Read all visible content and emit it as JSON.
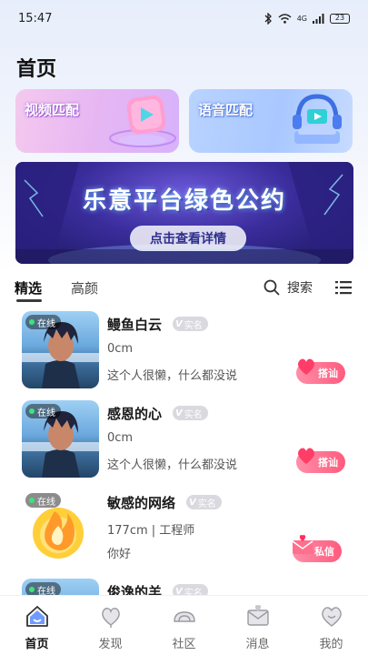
{
  "status_bar": {
    "time": "15:47",
    "network": "4G",
    "battery": "23"
  },
  "page_title": "首页",
  "match_cards": [
    {
      "label": "视频匹配"
    },
    {
      "label": "语音匹配"
    }
  ],
  "banner": {
    "title": "乐意平台绿色公约",
    "button": "点击查看详情"
  },
  "tabs": {
    "active": "精选",
    "inactive": "高颜"
  },
  "search": {
    "label": "搜索"
  },
  "users": [
    {
      "online": "在线",
      "name": "鳗鱼白云",
      "v_tag": "实名",
      "sub": "0cm",
      "sign": "这个人很懒，什么都没说",
      "action": "搭讪"
    },
    {
      "online": "在线",
      "name": "感恩的心",
      "v_tag": "实名",
      "sub": "0cm",
      "sign": "这个人很懒，什么都没说",
      "action": "搭讪"
    },
    {
      "online": "在线",
      "name": "敏感的网络",
      "v_tag": "实名",
      "sub": "177cm | 工程师",
      "sign": "你好",
      "action": "私信"
    },
    {
      "online": "在线",
      "name": "俊逸的羊",
      "v_tag": "实名"
    }
  ],
  "bottom_nav": [
    {
      "label": "首页",
      "icon": "home-icon"
    },
    {
      "label": "发现",
      "icon": "discover-icon"
    },
    {
      "label": "社区",
      "icon": "community-icon"
    },
    {
      "label": "消息",
      "icon": "message-icon"
    },
    {
      "label": "我的",
      "icon": "profile-icon"
    }
  ],
  "colors": {
    "accent_pink": "#ff5b7e",
    "online_green": "#3ee37a",
    "nav_active": "#111111"
  }
}
